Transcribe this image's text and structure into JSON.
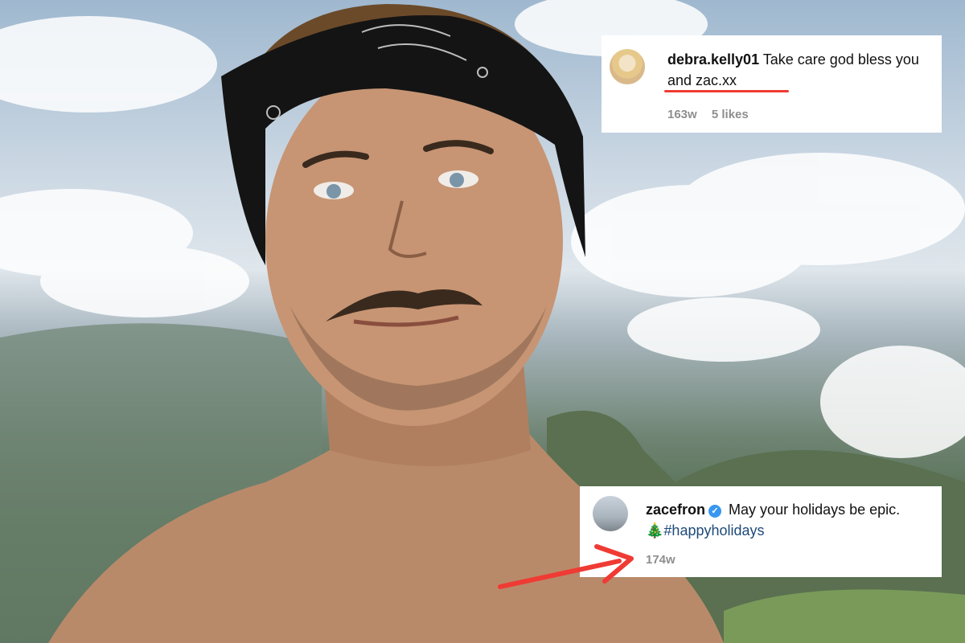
{
  "comment1": {
    "username": "debra.kelly01",
    "text_part1": "Take care god bless",
    "text_part2": "you and zac.xx",
    "time": "163w",
    "likes": "5 likes"
  },
  "comment2": {
    "username": "zacefron",
    "text": "May your holidays be epic.",
    "hashtag": "#happyholidays",
    "time": "174w",
    "tree_icon": "🎄"
  },
  "colors": {
    "highlight": "#ef3b34",
    "verified": "#3897f0",
    "meta": "#8e8e8e",
    "hashtag": "#1d4a7a"
  },
  "icons": {
    "verified": "check-badge-icon",
    "tree": "christmas-tree-icon",
    "arrow": "red-arrow-icon"
  }
}
